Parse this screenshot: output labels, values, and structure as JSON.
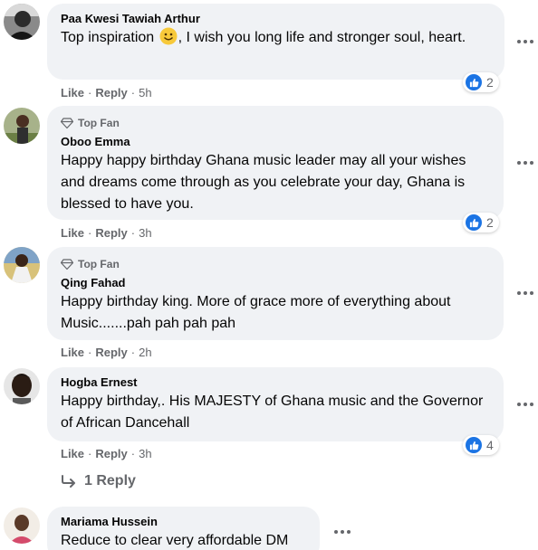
{
  "comments": [
    {
      "author": "Paa Kwesi Tawiah Arthur",
      "text_before": "Top inspiration ",
      "emoji": "slightly-smiling-face",
      "text_after": ", I wish you long life and stronger soul, heart.",
      "like_label": "Like",
      "reply_label": "Reply",
      "time": "5h",
      "reactions": "2"
    },
    {
      "badge": "Top Fan",
      "author": "Oboo Emma",
      "text": "Happy happy birthday Ghana music leader may all your wishes and dreams come through as you celebrate your day, Ghana is blessed to have you.",
      "like_label": "Like",
      "reply_label": "Reply",
      "time": "3h",
      "reactions": "2"
    },
    {
      "badge": "Top Fan",
      "author": "Qing Fahad",
      "text": "Happy birthday king. More of grace more of everything about Music.......pah pah pah pah",
      "like_label": "Like",
      "reply_label": "Reply",
      "time": "2h"
    },
    {
      "author": "Hogba Ernest",
      "text": "Happy birthday,. His MAJESTY of Ghana music and the Governor of African Dancehall",
      "like_label": "Like",
      "reply_label": "Reply",
      "time": "3h",
      "reactions": "4",
      "replies_label": "1 Reply"
    },
    {
      "author": "Mariama Hussein",
      "text": "Reduce to clear very affordable DM"
    }
  ],
  "icons": {
    "like": "like-thumb-icon",
    "more": "more-options-icon",
    "top_fan": "diamond-icon",
    "reply_arrow": "reply-arrow-icon"
  },
  "colors": {
    "bubble": "#f0f2f5",
    "secondary_text": "#65676b",
    "like_blue": "#1b74e4"
  }
}
